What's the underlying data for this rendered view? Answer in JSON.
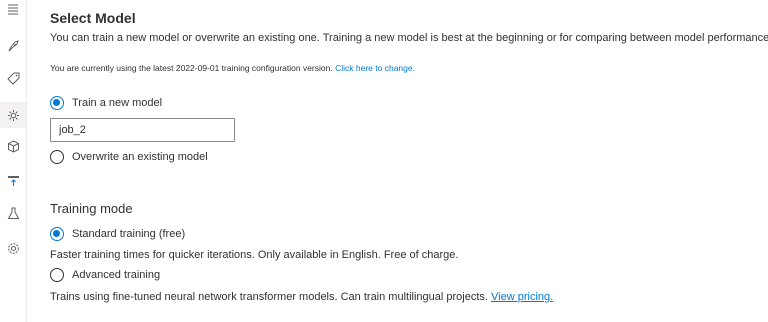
{
  "nav_rail": {
    "items": [
      {
        "icon": "hamburger-menu-icon"
      },
      {
        "icon": "rocket-icon"
      },
      {
        "icon": "tag-icon"
      },
      {
        "icon": "model-gear-icon",
        "active": true
      },
      {
        "icon": "cube-icon"
      },
      {
        "icon": "deploy-icon"
      },
      {
        "icon": "flask-icon"
      },
      {
        "icon": "settings-icon"
      }
    ]
  },
  "select_model": {
    "title": "Select Model",
    "description": "You can train a new model or overwrite an existing one. Training a new model is best at the beginning or for comparing between model performances.",
    "config_notice": "You are currently using the latest 2022-09-01 training configuration version.",
    "config_link": "Click here to change.",
    "options": [
      {
        "label": "Train a new model",
        "checked": true
      },
      {
        "label": "Overwrite an existing model",
        "checked": false
      }
    ],
    "model_name_value": "job_2"
  },
  "training_mode": {
    "title": "Training mode",
    "options": [
      {
        "label": "Standard training (free)",
        "checked": true,
        "description": "Faster training times for quicker iterations. Only available in English. Free of charge."
      },
      {
        "label": "Advanced training",
        "checked": false,
        "description": "Trains using fine-tuned neural network transformer models. Can train multilingual projects."
      }
    ],
    "pricing_link": "View pricing."
  },
  "colors": {
    "accent": "#0078d4",
    "text": "#323130",
    "border": "#8a8886"
  }
}
